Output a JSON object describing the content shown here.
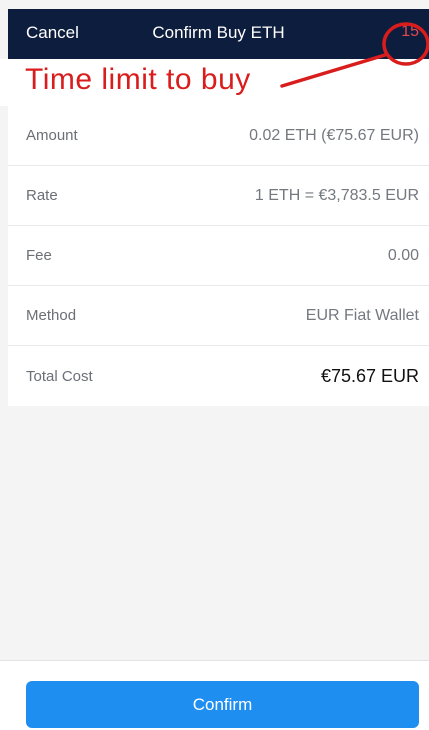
{
  "header": {
    "cancel_label": "Cancel",
    "title": "Confirm Buy ETH",
    "timer": "15"
  },
  "annotation": {
    "text": "Time limit to buy",
    "color": "#d91d1d"
  },
  "details": {
    "rows": [
      {
        "label": "Amount",
        "value": "0.02 ETH (€75.67 EUR)"
      },
      {
        "label": "Rate",
        "value": "1 ETH = €3,783.5 EUR"
      },
      {
        "label": "Fee",
        "value": "0.00"
      },
      {
        "label": "Method",
        "value": "EUR Fiat Wallet"
      },
      {
        "label": "Total Cost",
        "value": "€75.67 EUR"
      }
    ]
  },
  "footer": {
    "confirm_label": "Confirm"
  },
  "colors": {
    "header_bg": "#0d1d3e",
    "accent_blue": "#1f8ef1",
    "timer_red": "#e5484d"
  }
}
